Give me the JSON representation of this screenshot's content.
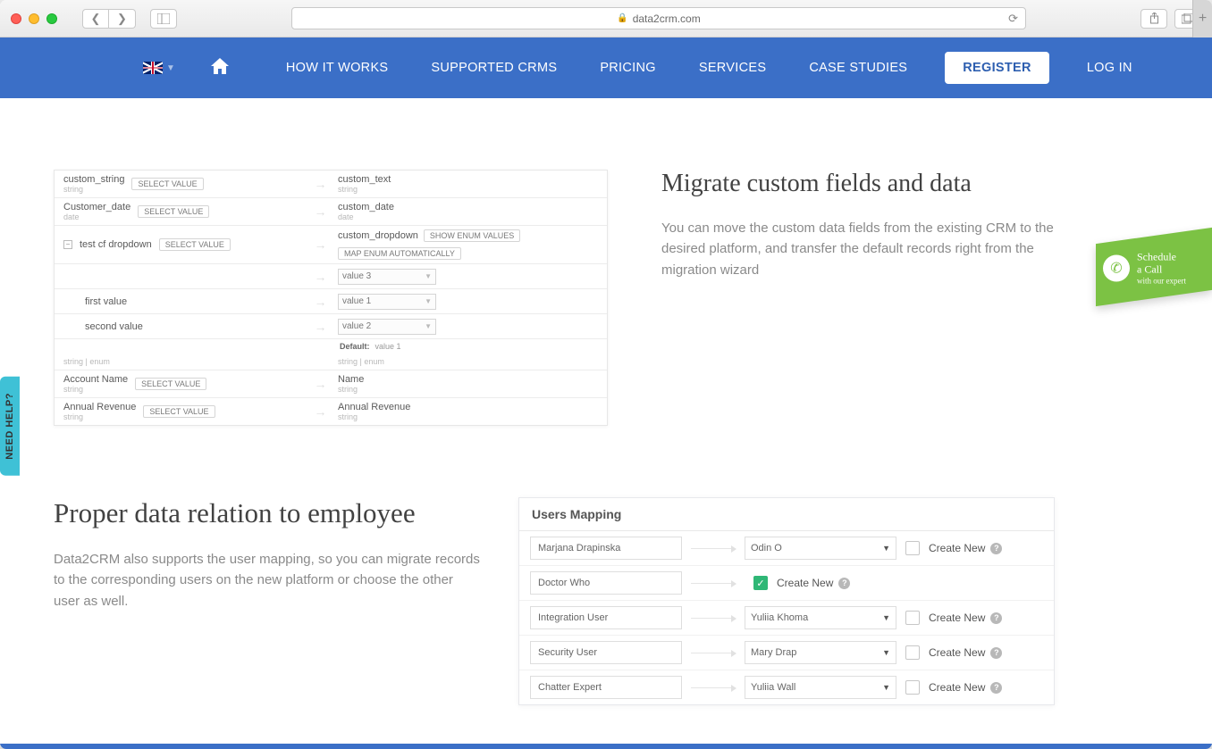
{
  "browser": {
    "url": "data2crm.com"
  },
  "nav": {
    "how_it_works": "HOW IT WORKS",
    "supported_crms": "SUPPORTED CRMS",
    "pricing": "PRICING",
    "services": "SERVICES",
    "case_studies": "CASE STUDIES",
    "register": "REGISTER",
    "login": "LOG IN"
  },
  "side": {
    "need_help": "NEED HELP?",
    "schedule_line1": "Schedule",
    "schedule_line2": "a Call",
    "schedule_sub": "with our expert"
  },
  "section_custom": {
    "heading": "Migrate custom fields and data",
    "body": "You can move the custom data fields from the existing CRM to the desired platform, and transfer the default records right from the migration wizard"
  },
  "section_users": {
    "heading": "Proper data relation to employee",
    "body": "Data2CRM also supports the user mapping, so you can migrate records to the corresponding users on the new platform or choose the other user as well."
  },
  "field_panel": {
    "select_value": "SELECT VALUE",
    "show_enum": "SHOW ENUM VALUES",
    "map_enum": "MAP ENUM AUTOMATICALLY",
    "default_label": "Default:",
    "rows": [
      {
        "left": "custom_string",
        "ltype": "string",
        "right": "custom_text",
        "rtype": "string"
      },
      {
        "left": "Customer_date",
        "ltype": "date",
        "right": "custom_date",
        "rtype": "date"
      },
      {
        "left": "test cf dropdown",
        "ltype": "string | enum",
        "right": "custom_dropdown",
        "rtype": "string | enum",
        "expandable": true
      },
      {
        "sub": true,
        "left": "first value",
        "right_dd": "value 1"
      },
      {
        "sub": true,
        "left": "second value",
        "right_dd": "value 2"
      },
      {
        "left": "Account Name",
        "ltype": "string",
        "right": "Name",
        "rtype": "string"
      },
      {
        "left": "Annual Revenue",
        "ltype": "string",
        "right": "Annual Revenue",
        "rtype": "string"
      }
    ],
    "top_dd": "value 3",
    "default_value": "value 1"
  },
  "users_panel": {
    "title": "Users Mapping",
    "create_new": "Create New",
    "rows": [
      {
        "src": "Marjana Drapinska",
        "dst": "Odin O",
        "checked": false,
        "has_select": true
      },
      {
        "src": "Doctor Who",
        "dst": "",
        "checked": true,
        "has_select": false
      },
      {
        "src": "Integration User",
        "dst": "Yuliia Khoma",
        "checked": false,
        "has_select": true
      },
      {
        "src": "Security User",
        "dst": "Mary Drap",
        "checked": false,
        "has_select": true
      },
      {
        "src": "Chatter Expert",
        "dst": "Yuliia Wall",
        "checked": false,
        "has_select": true
      }
    ]
  }
}
